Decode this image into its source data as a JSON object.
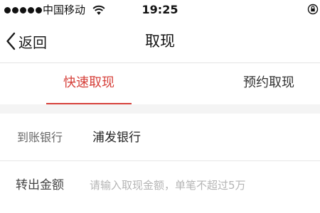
{
  "status_bar": {
    "carrier": "中国移动",
    "time": "19:25",
    "signal_bars": 5
  },
  "nav": {
    "back_label": "返回",
    "title": "取现"
  },
  "tabs": [
    {
      "label": "快速取现",
      "active": true
    },
    {
      "label": "预约取现",
      "active": false
    }
  ],
  "form": {
    "bank_label": "到账银行",
    "bank_value": "浦发银行",
    "amount_label": "转出金额",
    "amount_value": "",
    "amount_placeholder": "请输入取现金额，单笔不超过5万"
  },
  "colors": {
    "accent": "#d6403a",
    "background": "#f4f4f4"
  },
  "icons": [
    "signal-icon",
    "wifi-icon",
    "rotation-lock-icon",
    "chevron-left-icon"
  ]
}
